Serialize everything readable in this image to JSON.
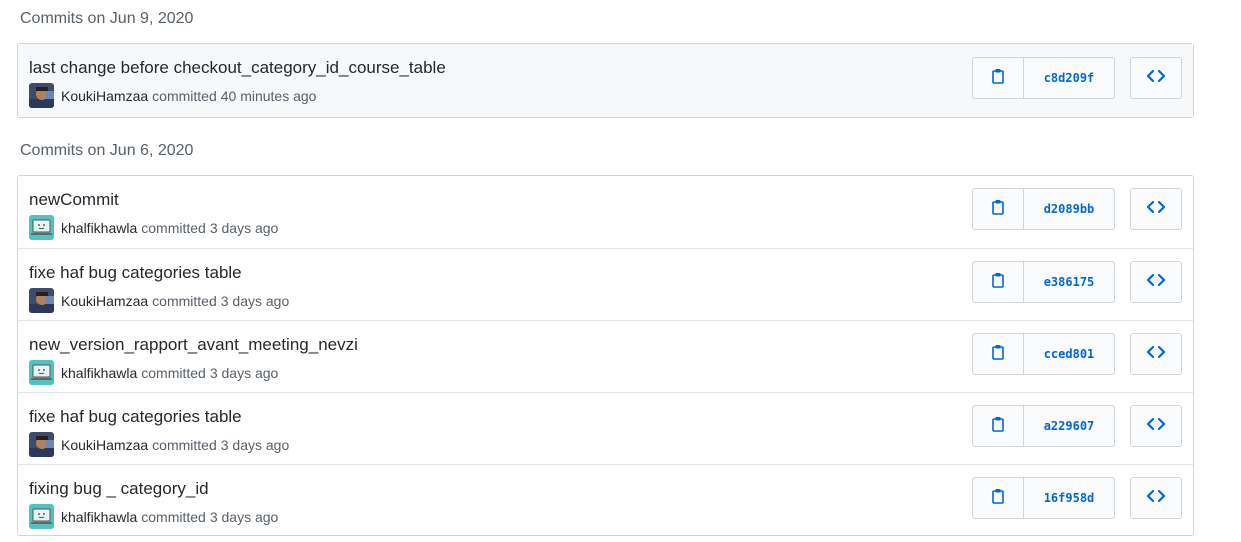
{
  "groups": [
    {
      "title": "Commits on Jun 9, 2020",
      "commits": [
        {
          "message": "last change before checkout_category_id_course_table",
          "author": "KoukiHamzaa",
          "verb": "committed",
          "time": "40 minutes ago",
          "sha": "c8d209f",
          "avatar": "photo-avatar"
        }
      ]
    },
    {
      "title": "Commits on Jun 6, 2020",
      "commits": [
        {
          "message": "newCommit",
          "author": "khalfikhawla",
          "verb": "committed",
          "time": "3 days ago",
          "sha": "d2089bb",
          "avatar": "laptop-avatar"
        },
        {
          "message": "fixe haf bug categories table",
          "author": "KoukiHamzaa",
          "verb": "committed",
          "time": "3 days ago",
          "sha": "e386175",
          "avatar": "photo-avatar"
        },
        {
          "message": "new_version_rapport_avant_meeting_nevzi",
          "author": "khalfikhawla",
          "verb": "committed",
          "time": "3 days ago",
          "sha": "cced801",
          "avatar": "laptop-avatar"
        },
        {
          "message": "fixe haf bug categories table",
          "author": "KoukiHamzaa",
          "verb": "committed",
          "time": "3 days ago",
          "sha": "a229607",
          "avatar": "photo-avatar"
        },
        {
          "message": "fixing bug _ category_id",
          "author": "khalfikhawla",
          "verb": "committed",
          "time": "3 days ago",
          "sha": "16f958d",
          "avatar": "laptop-avatar"
        }
      ]
    }
  ],
  "icons": {
    "copy": "clippy-icon",
    "browse": "code-icon"
  },
  "colors": {
    "link": "#0366d6",
    "text": "#24292e",
    "muted": "#586069",
    "border": "#d1d5da",
    "highlight_row": "#f6f8fa"
  }
}
